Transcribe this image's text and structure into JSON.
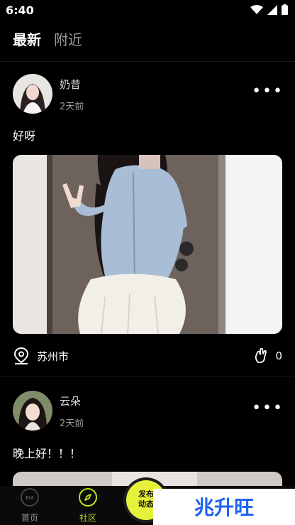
{
  "status_bar": {
    "time": "6:40"
  },
  "tabs": {
    "latest": "最新",
    "nearby": "附近"
  },
  "posts": [
    {
      "username": "奶昔",
      "time": "2天前",
      "text": "好呀",
      "location": "苏州市",
      "likes": "0"
    },
    {
      "username": "云朵",
      "time": "2天前",
      "text": "晚上好！！！"
    }
  ],
  "nav": {
    "home": "首页",
    "community": "社区",
    "publish": "发布动态",
    "home_badge": "Ent"
  },
  "watermark": "兆升旺",
  "colors": {
    "accent": "#e6f23a",
    "nav_active": "#b8e21a",
    "background": "#000000"
  }
}
